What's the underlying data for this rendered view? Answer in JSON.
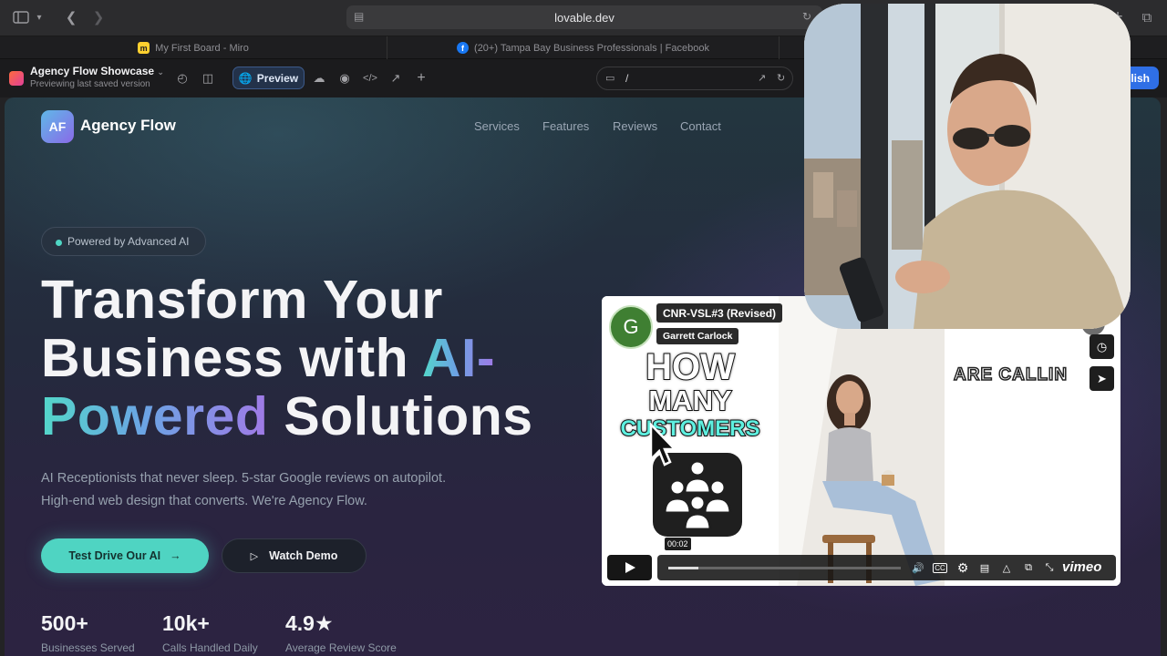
{
  "browser": {
    "url": "lovable.dev",
    "tabs": [
      {
        "title": "My First Board - Miro",
        "favicon": "miro-icon",
        "favicon_color": "#ffd02f"
      },
      {
        "title": "(20+) Tampa Bay Business Professionals | Facebook",
        "favicon": "facebook-icon",
        "favicon_color": "#1877f2"
      }
    ]
  },
  "editor": {
    "project_name": "Agency Flow Showcase",
    "project_status": "Previewing last saved version",
    "preview_label": "Preview",
    "path": "/",
    "publish_label": "Publish",
    "publish_visible_label": "blish"
  },
  "site": {
    "logo_initials": "AF",
    "brand": "Agency Flow",
    "nav": [
      "Services",
      "Features",
      "Reviews",
      "Contact"
    ],
    "badge": "Powered by Advanced AI",
    "headline": {
      "part1": "Transform Your",
      "part2": "Business with ",
      "highlight1": "AI-",
      "highlight2": "Powered",
      "part3": " Solutions"
    },
    "subcopy_line1": "AI Receptionists that never sleep. 5-star Google reviews on autopilot.",
    "subcopy_line2": "High-end web design that converts. We're Agency Flow.",
    "cta_primary": "Test Drive Our AI",
    "cta_secondary": "Watch Demo",
    "stats": [
      {
        "value": "500+",
        "label": "Businesses Served"
      },
      {
        "value": "10k+",
        "label": "Calls Handled Daily"
      },
      {
        "value": "4.9★",
        "label": "Average Review Score"
      }
    ],
    "accent": "#4fd4c2"
  },
  "video": {
    "avatar_initial": "G",
    "title": "CNR-VSL#3 (Revised)",
    "author": "Garrett Carlock",
    "overlay_line1": "HOW",
    "overlay_line2": "MANY",
    "overlay_line3": "CUSTOMERS",
    "overlay_partial": "ARE CALLIN",
    "time": "00:02",
    "progress_fraction": 0.13,
    "brand": "vimeo"
  }
}
